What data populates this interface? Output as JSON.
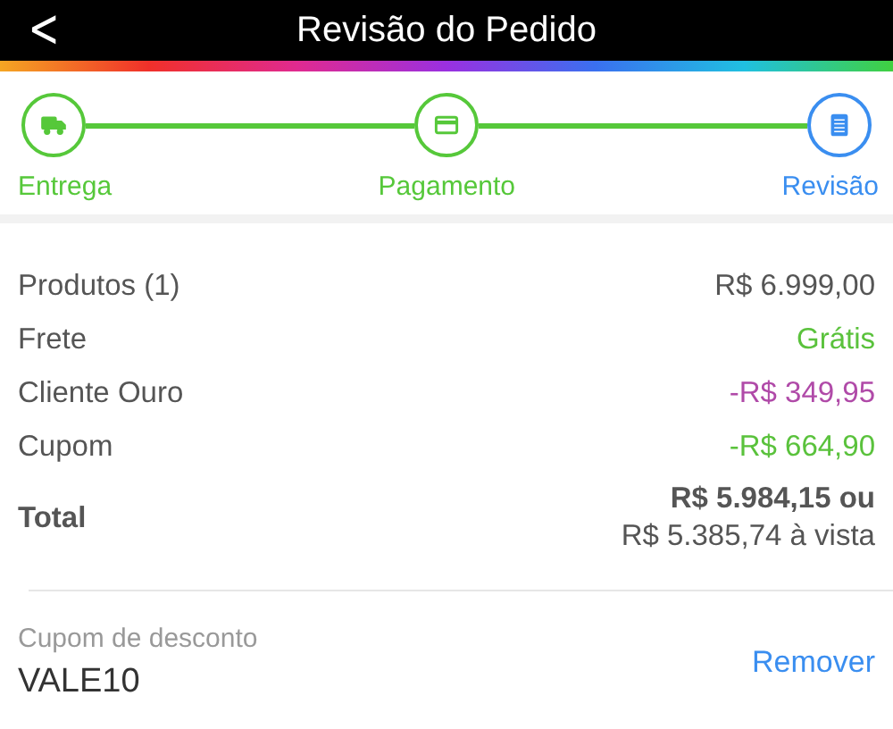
{
  "header": {
    "back": "<",
    "title": "Revisão do Pedido"
  },
  "steps": [
    {
      "label": "Entrega",
      "selected": false
    },
    {
      "label": "Pagamento",
      "selected": false
    },
    {
      "label": "Revisão",
      "selected": true
    }
  ],
  "summary": [
    {
      "kind": "line",
      "label": "Produtos (1)",
      "value": "R$ 6.999,00",
      "color": "#555555"
    },
    {
      "kind": "line",
      "label": "Frete",
      "value": "Grátis",
      "color": "#5ac23c"
    },
    {
      "kind": "line",
      "label": "Cliente Ouro",
      "value": "-R$ 349,95",
      "color": "#b04aa8"
    },
    {
      "kind": "line",
      "label": "Cupom",
      "value": "-R$ 664,90",
      "color": "#5ac23c"
    },
    {
      "kind": "total",
      "label": "Total",
      "value": "R$ 5.984,15 ou",
      "value_2": "R$ 5.385,74 à vista",
      "color": "#555555"
    }
  ],
  "coupon": {
    "label": "Cupom de desconto",
    "code": "VALE10",
    "action": "Remover"
  }
}
